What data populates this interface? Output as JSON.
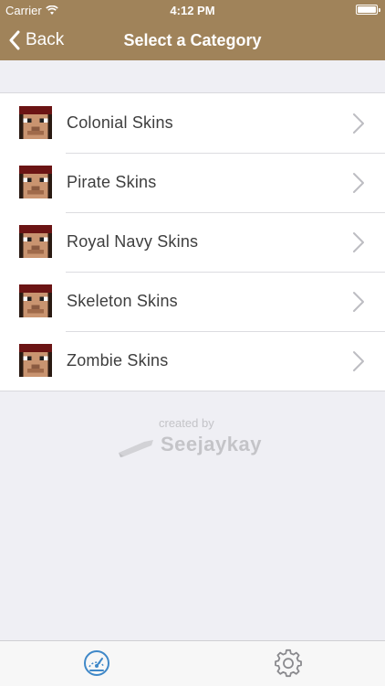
{
  "status_bar": {
    "carrier": "Carrier",
    "time": "4:12 PM"
  },
  "nav": {
    "back_label": "Back",
    "title": "Select a Category"
  },
  "categories": [
    {
      "label": "Colonial Skins"
    },
    {
      "label": "Pirate Skins"
    },
    {
      "label": "Royal Navy Skins"
    },
    {
      "label": "Skeleton Skins"
    },
    {
      "label": "Zombie Skins"
    }
  ],
  "credit": {
    "prefix": "created by",
    "name": "Seejaykay"
  },
  "tabs": [
    {
      "icon": "speedometer-icon"
    },
    {
      "icon": "gear-icon"
    }
  ],
  "colors": {
    "accent": "#a0835a",
    "tab_active": "#3f88c8",
    "tab_inactive": "#8a8a8e"
  }
}
